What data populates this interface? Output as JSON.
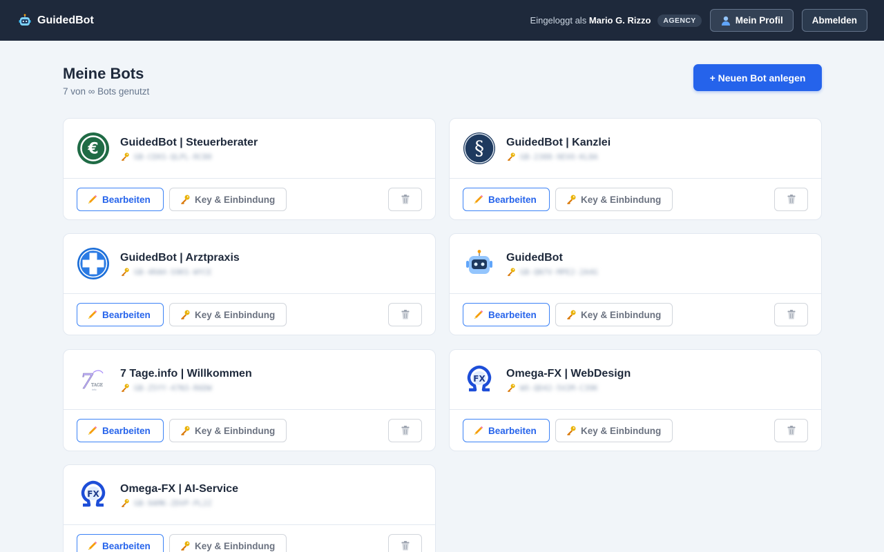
{
  "brand": {
    "name": "GuidedBot",
    "icon": "robot-icon"
  },
  "topbar": {
    "logged_in_prefix": "Eingeloggt als",
    "user_name": "Mario G. Rizzo",
    "role_badge": "AGENCY",
    "profile_label": "Mein Profil",
    "logout_label": "Abmelden"
  },
  "page": {
    "title": "Meine Bots",
    "subtitle": "7 von ∞ Bots genutzt",
    "new_bot_label": "+ Neuen Bot anlegen"
  },
  "card_actions": {
    "edit_label": "Bearbeiten",
    "key_label": "Key & Einbindung",
    "edit_icon": "pencil-icon",
    "key_icon": "key-icon",
    "delete_icon": "trash-icon"
  },
  "bots": [
    {
      "name": "GuidedBot | Steuerberater",
      "key": "GB-CEKS-QLPL-RC80",
      "avatar": "euro-icon"
    },
    {
      "name": "GuidedBot | Kanzlei",
      "key": "GB-2388-9EVO-KL8A",
      "avatar": "paragraph-icon"
    },
    {
      "name": "GuidedBot | Arztpraxis",
      "key": "GB-4RAH-S9KS-WYCE",
      "avatar": "medical-cross-icon"
    },
    {
      "name": "GuidedBot",
      "key": "GB-QN7V-MPE2-2A4G",
      "avatar": "robot-icon"
    },
    {
      "name": "7 Tage.info | Willkommen",
      "key": "GB-Z5YY-47N3-R6DW",
      "avatar": "7tage-logo-icon"
    },
    {
      "name": "Omega-FX | WebDesign",
      "key": "WX-QD42-5V2M-C39K",
      "avatar": "omega-fx-logo-icon"
    },
    {
      "name": "Omega-FX | AI-Service",
      "key": "GB-9AMK-ZDVP-PL2Z",
      "avatar": "omega-fx-logo-icon"
    }
  ],
  "colors": {
    "topbar": "#1e293b",
    "accent": "#2563eb",
    "background": "#f1f5f9"
  }
}
